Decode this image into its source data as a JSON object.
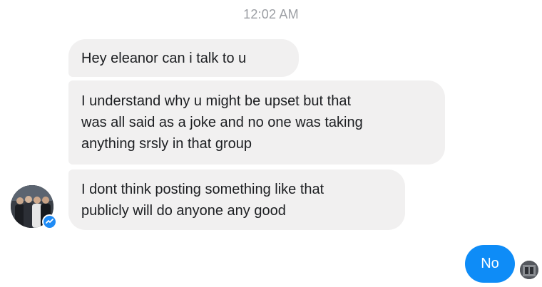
{
  "conversation": {
    "timestamp": "12:02 AM",
    "received_messages": [
      {
        "text": "Hey eleanor can i talk to u"
      },
      {
        "text": "I understand why u might be upset but that\nwas all said as a joke and no one was taking\nanything srsly in that group"
      },
      {
        "text": "I dont think posting something like that\npublicly will do anyone any good"
      }
    ],
    "sent_messages": [
      {
        "text": "No"
      }
    ]
  },
  "colors": {
    "received_bubble": "#f1f0f0",
    "sent_bubble": "#0e8cf7",
    "timestamp_text": "#9b9ea3",
    "messenger_badge": "#1f8bf5"
  },
  "icons": {
    "sender_avatar": "group-photo-avatar",
    "badge": "messenger-icon",
    "own_avatar": "user-avatar"
  }
}
